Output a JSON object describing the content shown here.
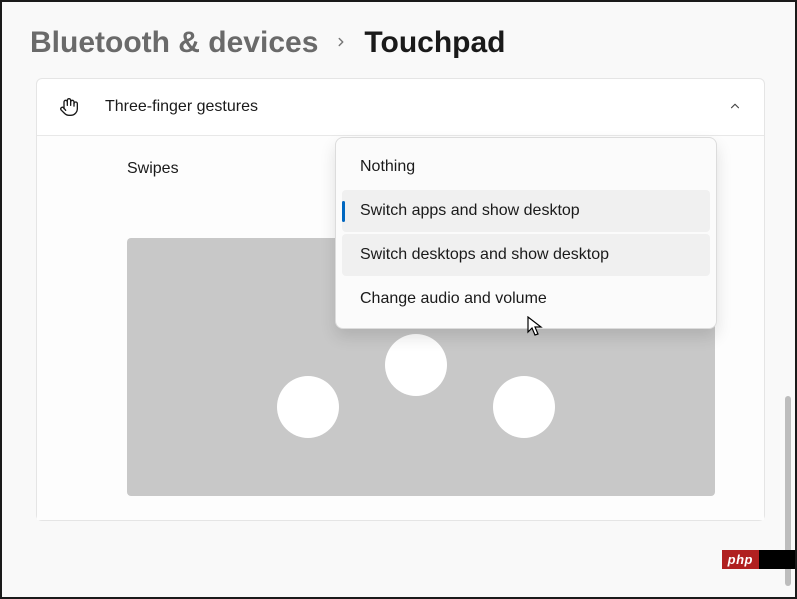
{
  "breadcrumb": {
    "parent": "Bluetooth & devices",
    "current": "Touchpad"
  },
  "section": {
    "title": "Three-finger gestures",
    "row_label": "Swipes"
  },
  "dropdown": {
    "options": [
      "Nothing",
      "Switch apps and show desktop",
      "Switch desktops and show desktop",
      "Change audio and volume"
    ]
  },
  "watermark": {
    "text": "php"
  }
}
